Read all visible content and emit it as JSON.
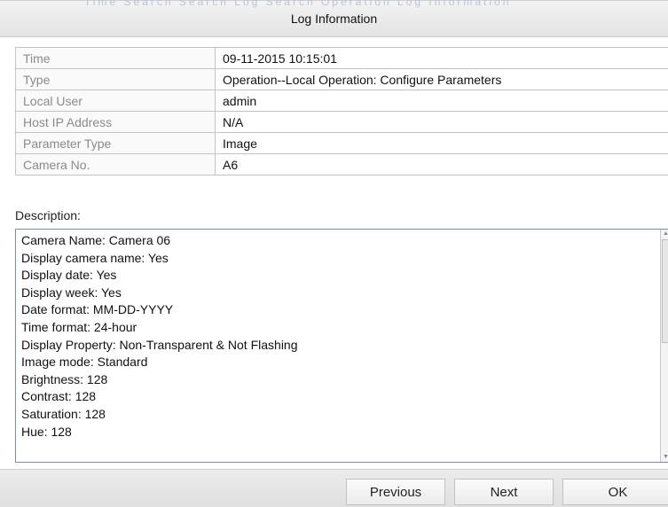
{
  "dialog": {
    "background_menu_hint": "Time Search      Search      Log Search      Operation      Log Information",
    "title": "Log Information"
  },
  "info": [
    {
      "key": "Time",
      "value": "09-11-2015 10:15:01"
    },
    {
      "key": "Type",
      "value": "Operation--Local Operation: Configure Parameters"
    },
    {
      "key": "Local User",
      "value": "admin"
    },
    {
      "key": "Host IP Address",
      "value": "N/A"
    },
    {
      "key": "Parameter Type",
      "value": "Image"
    },
    {
      "key": "Camera No.",
      "value": "A6"
    }
  ],
  "description": {
    "label": "Description:",
    "lines": [
      "Camera Name: Camera 06",
      "Display camera name: Yes",
      "Display date: Yes",
      "Display week: Yes",
      "Date format: MM-DD-YYYY",
      "Time format: 24-hour",
      "Display Property: Non-Transparent & Not Flashing",
      "Image mode: Standard",
      "Brightness: 128",
      "Contrast: 128",
      "Saturation: 128",
      "Hue: 128"
    ]
  },
  "buttons": {
    "previous": "Previous",
    "next": "Next",
    "ok": "OK"
  },
  "icons": {
    "scroll_up": "scroll-up-arrow-icon",
    "scroll_down": "scroll-down-arrow-icon"
  },
  "colors": {
    "title_bar": "#e8e8e8",
    "key_text": "#8a8a8a",
    "value_text": "#111111",
    "desc_border": "#7c8ea6"
  }
}
